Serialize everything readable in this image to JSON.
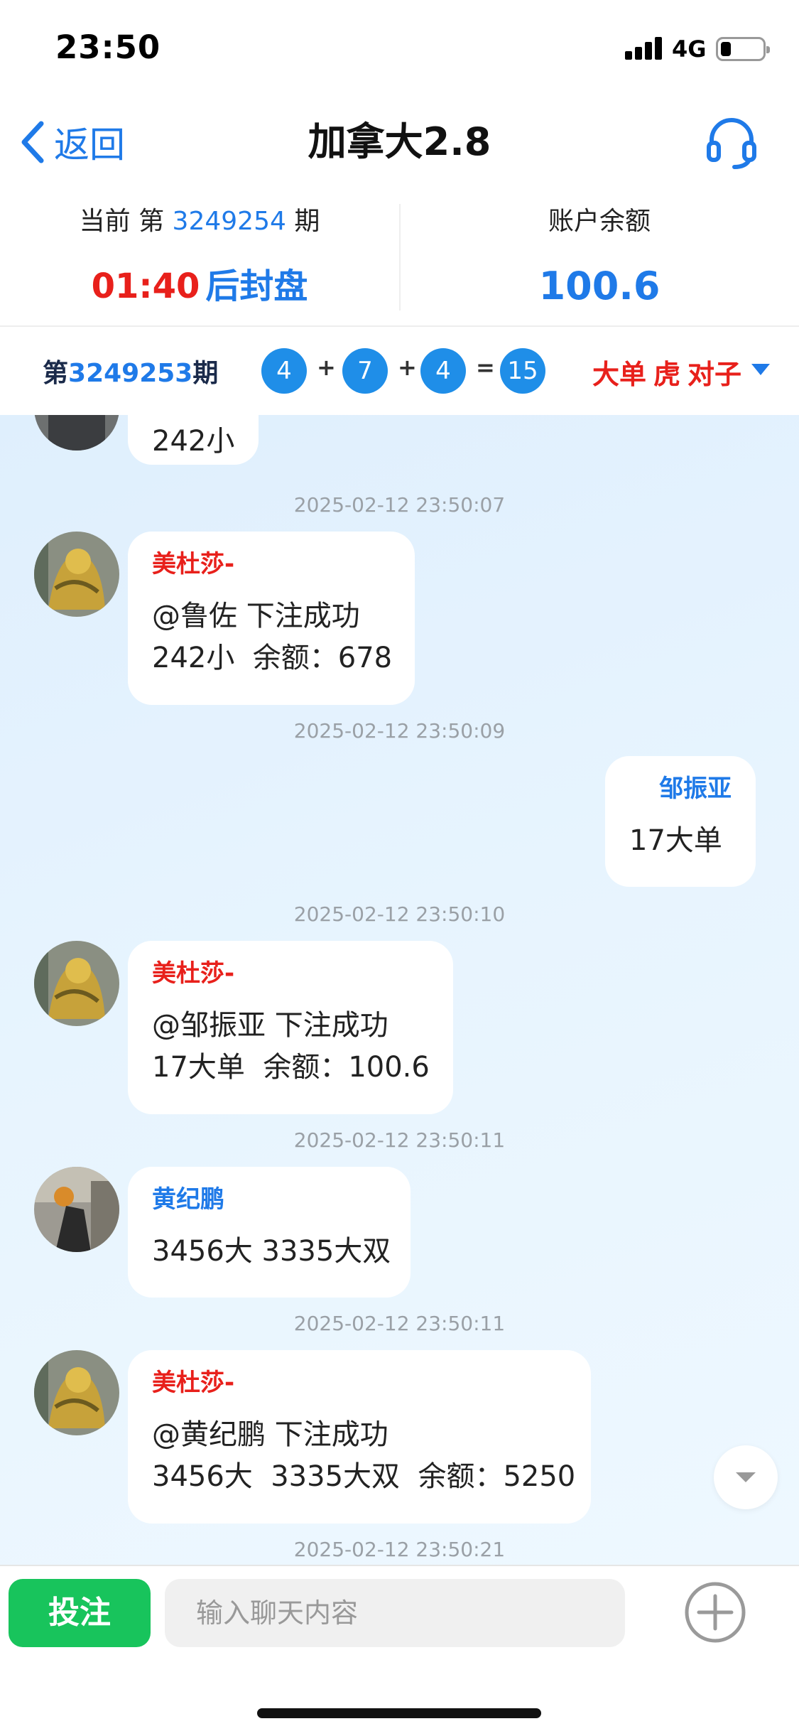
{
  "status_bar": {
    "time": "23:50",
    "network": "4G"
  },
  "nav": {
    "back_label": "返回",
    "title": "加拿大2.8"
  },
  "info": {
    "current_prefix": "当前 第 ",
    "current_period": "3249254",
    "current_suffix": " 期",
    "countdown": "01:40",
    "close_label": "后封盘",
    "balance_label": "账户余额",
    "balance_value": "100.6"
  },
  "last_result": {
    "prefix": "第",
    "period": "3249253",
    "suffix": "期",
    "balls": [
      "4",
      "7",
      "4",
      "15"
    ],
    "ops": [
      "+",
      "+",
      "="
    ],
    "tags": [
      "大单",
      "虎",
      "对子"
    ]
  },
  "chat": {
    "messages": [
      {
        "kind": "partial",
        "text": "242小"
      },
      {
        "timestamp": "2025-02-12 23:50:07",
        "side": "left",
        "sender": "美杜莎-",
        "sender_color": "#e8201b",
        "avatar": "gold-statue",
        "lines": [
          "@鲁佐 下注成功",
          "242小  余额：678"
        ]
      },
      {
        "timestamp": "2025-02-12 23:50:09",
        "side": "right",
        "sender": "邹振亚",
        "sender_color": "#1f7ae8",
        "lines": [
          "17大单"
        ]
      },
      {
        "timestamp": "2025-02-12 23:50:10",
        "side": "left",
        "sender": "美杜莎-",
        "sender_color": "#e8201b",
        "avatar": "gold-statue",
        "lines": [
          "@邹振亚 下注成功",
          "17大单  余额：100.6"
        ]
      },
      {
        "timestamp": "2025-02-12 23:50:11",
        "side": "left",
        "sender": "黄纪鹏",
        "sender_color": "#1f7ae8",
        "avatar": "person",
        "lines": [
          "3456大 3335大双"
        ]
      },
      {
        "timestamp": "2025-02-12 23:50:11",
        "side": "left",
        "sender": "美杜莎-",
        "sender_color": "#e8201b",
        "avatar": "gold-statue",
        "lines": [
          "@黄纪鹏 下注成功",
          "3456大  3335大双  余额：5250"
        ]
      },
      {
        "timestamp": "2025-02-12 23:50:21"
      }
    ]
  },
  "bottom": {
    "bet_label": "投注",
    "input_placeholder": "输入聊天内容"
  }
}
